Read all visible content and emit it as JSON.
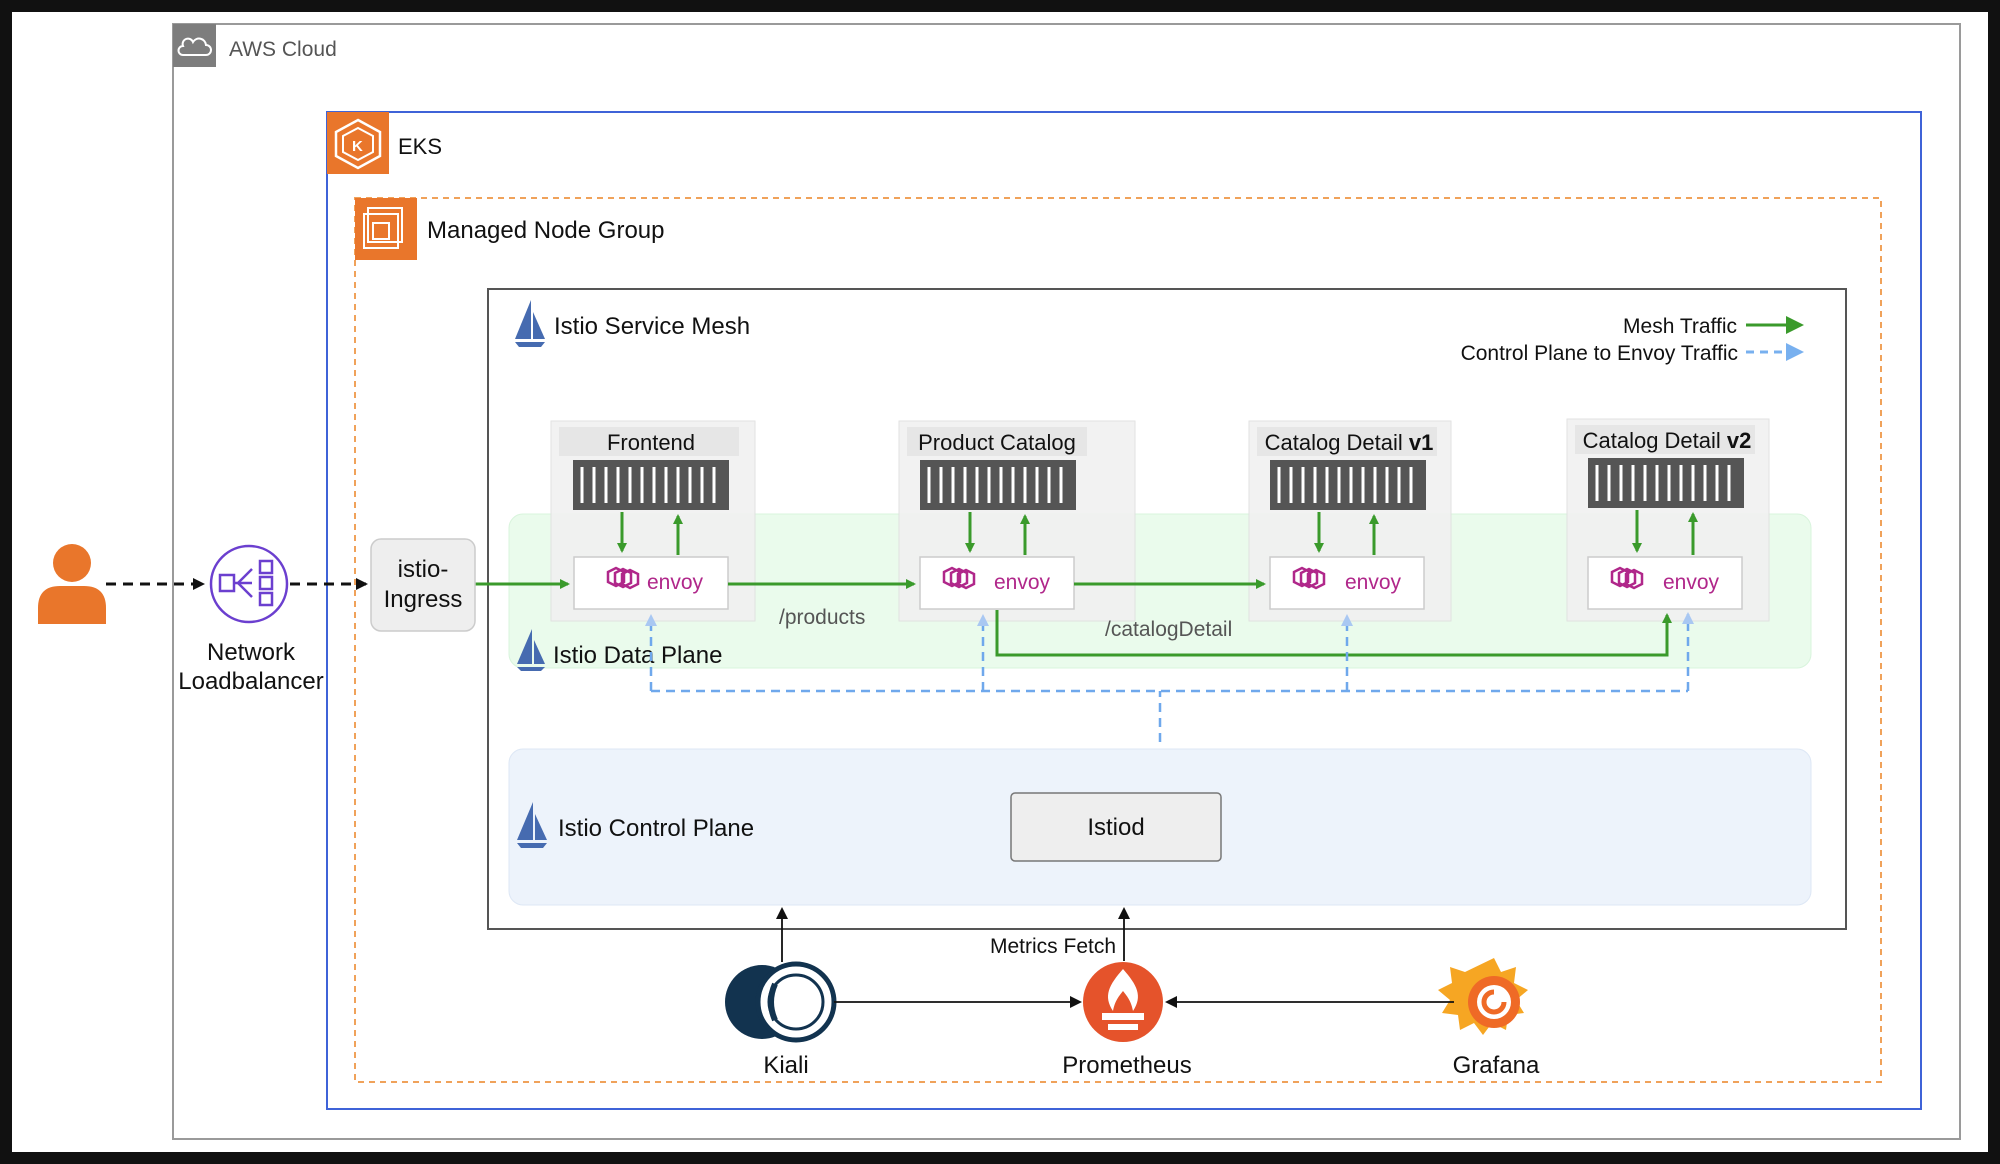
{
  "aws_cloud": {
    "label": "AWS Cloud"
  },
  "eks": {
    "label": "EKS"
  },
  "node_group": {
    "label": "Managed Node Group"
  },
  "mesh": {
    "label": "Istio Service Mesh"
  },
  "data_plane": {
    "label": "Istio Data Plane"
  },
  "control_plane": {
    "label": "Istio Control Plane"
  },
  "istiod": {
    "label": "Istiod"
  },
  "legend": {
    "mesh_traffic": "Mesh Traffic",
    "control_traffic": "Control Plane to Envoy Traffic",
    "mesh_color": "#3a9a2b",
    "control_color": "#6fa8ec"
  },
  "nlb": {
    "line1": "Network",
    "line2": "Loadbalancer"
  },
  "ingress": {
    "line1": "istio-",
    "line2": "Ingress"
  },
  "services": [
    {
      "name": "Frontend",
      "suffix": ""
    },
    {
      "name": "Product Catalog",
      "suffix": ""
    },
    {
      "name": "Catalog Detail ",
      "suffix": "v1"
    },
    {
      "name": "Catalog Detail ",
      "suffix": "v2"
    }
  ],
  "envoy_label": "envoy",
  "routes": {
    "products": "/products",
    "catalog_detail": "/catalogDetail"
  },
  "metrics_fetch": "Metrics Fetch",
  "tools": {
    "kiali": "Kiali",
    "prometheus": "Prometheus",
    "grafana": "Grafana"
  },
  "icons": [
    "cloud-icon",
    "eks-icon",
    "node-group-icon",
    "istio-sail-icon",
    "user-icon",
    "network-loadbalancer-icon",
    "container-icon",
    "envoy-icon",
    "kiali-icon",
    "prometheus-icon",
    "grafana-icon"
  ]
}
